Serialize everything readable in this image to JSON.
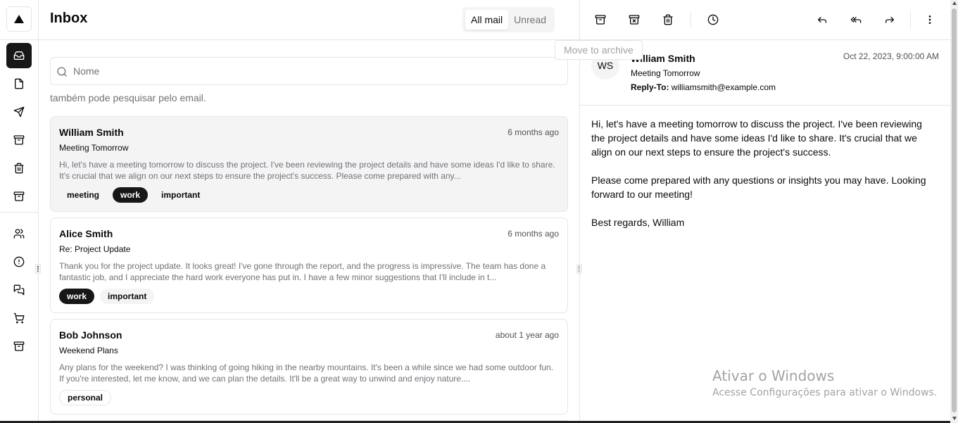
{
  "header": {
    "title": "Inbox"
  },
  "tabs": [
    {
      "label": "All mail",
      "active": true
    },
    {
      "label": "Unread",
      "active": false
    }
  ],
  "search": {
    "placeholder": "Nome",
    "hint": "também pode pesquisar pelo email."
  },
  "rail": {
    "logo_icon": "triangle-logo-icon",
    "items": [
      {
        "icon": "inbox-icon",
        "active": true
      },
      {
        "icon": "file-icon"
      },
      {
        "icon": "send-icon"
      },
      {
        "icon": "archive-icon"
      },
      {
        "icon": "trash-icon"
      },
      {
        "icon": "archive-box-icon"
      },
      {
        "icon": "users-icon"
      },
      {
        "icon": "alert-circle-icon"
      },
      {
        "icon": "messages-icon"
      },
      {
        "icon": "shopping-cart-icon"
      },
      {
        "icon": "archive-icon"
      }
    ]
  },
  "mails": [
    {
      "sender": "William Smith",
      "date": "6 months ago",
      "subject": "Meeting Tomorrow",
      "preview": "Hi, let's have a meeting tomorrow to discuss the project. I've been reviewing the project details and have some ideas I'd like to share. It's crucial that we align on our next steps to ensure the project's success. Please come prepared with any...",
      "tags": [
        {
          "label": "meeting",
          "dark": false
        },
        {
          "label": "work",
          "dark": true
        },
        {
          "label": "important",
          "dark": false
        }
      ]
    },
    {
      "sender": "Alice Smith",
      "date": "6 months ago",
      "subject": "Re: Project Update",
      "preview": "Thank you for the project update. It looks great! I've gone through the report, and the progress is impressive. The team has done a fantastic job, and I appreciate the hard work everyone has put in. I have a few minor suggestions that I'll include in t...",
      "tags": [
        {
          "label": "work",
          "dark": true
        },
        {
          "label": "important",
          "dark": false
        }
      ]
    },
    {
      "sender": "Bob Johnson",
      "date": "about 1 year ago",
      "subject": "Weekend Plans",
      "preview": "Any plans for the weekend? I was thinking of going hiking in the nearby mountains. It's been a while since we had some outdoor fun. If you're interested, let me know, and we can plan the details. It'll be a great way to unwind and enjoy nature....",
      "tags": [
        {
          "label": "personal",
          "dark": false
        }
      ]
    }
  ],
  "toolbar": {
    "tooltip": "Move to archive",
    "icons": [
      "archive-icon",
      "archive-x-icon",
      "trash-icon",
      "clock-icon",
      "reply-icon",
      "reply-all-icon",
      "forward-icon",
      "more-vertical-icon"
    ]
  },
  "detail": {
    "avatar": "WS",
    "name": "William Smith",
    "subject": "Meeting Tomorrow",
    "reply_to_label": "Reply-To:",
    "reply_to": "williamsmith@example.com",
    "date": "Oct 22, 2023, 9:00:00 AM",
    "body": "Hi, let's have a meeting tomorrow to discuss the project. I've been reviewing the project details and have some ideas I'd like to share. It's crucial that we align on our next steps to ensure the project's success.\n\nPlease come prepared with any questions or insights you may have. Looking forward to our meeting!\n\nBest regards, William"
  },
  "watermark": {
    "title": "Ativar o Windows",
    "subtitle": "Acesse Configurações para ativar o Windows."
  }
}
